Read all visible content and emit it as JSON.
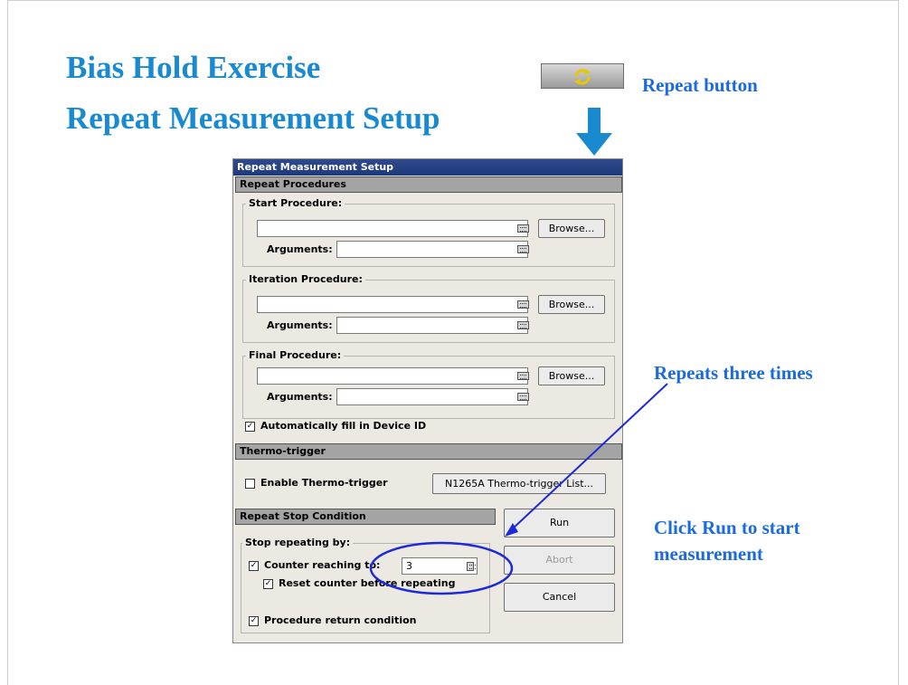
{
  "slide": {
    "title_line1": "Bias Hold Exercise",
    "title_line2": "Repeat Measurement Setup",
    "annotation_repeat_button": "Repeat button",
    "annotation_repeats": "Repeats three times",
    "annotation_run_line1": "Click Run to start",
    "annotation_run_line2": "measurement",
    "accent_color": "#1a8ad0",
    "annotation_color": "#1a6ae0",
    "repeat_icon": "refresh-cycle-icon"
  },
  "dialog": {
    "title": "Repeat Measurement Setup",
    "repeat_procedures": {
      "header": "Repeat Procedures",
      "start": {
        "label": "Start Procedure:",
        "value": "",
        "arguments_label": "Arguments:",
        "arguments_value": "",
        "browse": "Browse..."
      },
      "iteration": {
        "label": "Iteration Procedure:",
        "value": "",
        "arguments_label": "Arguments:",
        "arguments_value": "",
        "browse": "Browse..."
      },
      "final": {
        "label": "Final Procedure:",
        "value": "",
        "arguments_label": "Arguments:",
        "arguments_value": "",
        "browse": "Browse..."
      },
      "auto_fill_label": "Automatically fill in Device ID",
      "auto_fill_checked": true
    },
    "thermo": {
      "header": "Thermo-trigger",
      "enable_label": "Enable Thermo-trigger",
      "enable_checked": false,
      "list_button": "N1265A Thermo-trigger List..."
    },
    "stop": {
      "header": "Repeat Stop Condition",
      "group_label": "Stop repeating by:",
      "counter_label": "Counter reaching to:",
      "counter_checked": true,
      "counter_value": "3",
      "reset_label": "Reset counter before repeating",
      "reset_checked": true,
      "procedure_label": "Procedure return condition",
      "procedure_checked": true
    },
    "buttons": {
      "run": "Run",
      "abort": "Abort",
      "cancel": "Cancel"
    }
  }
}
